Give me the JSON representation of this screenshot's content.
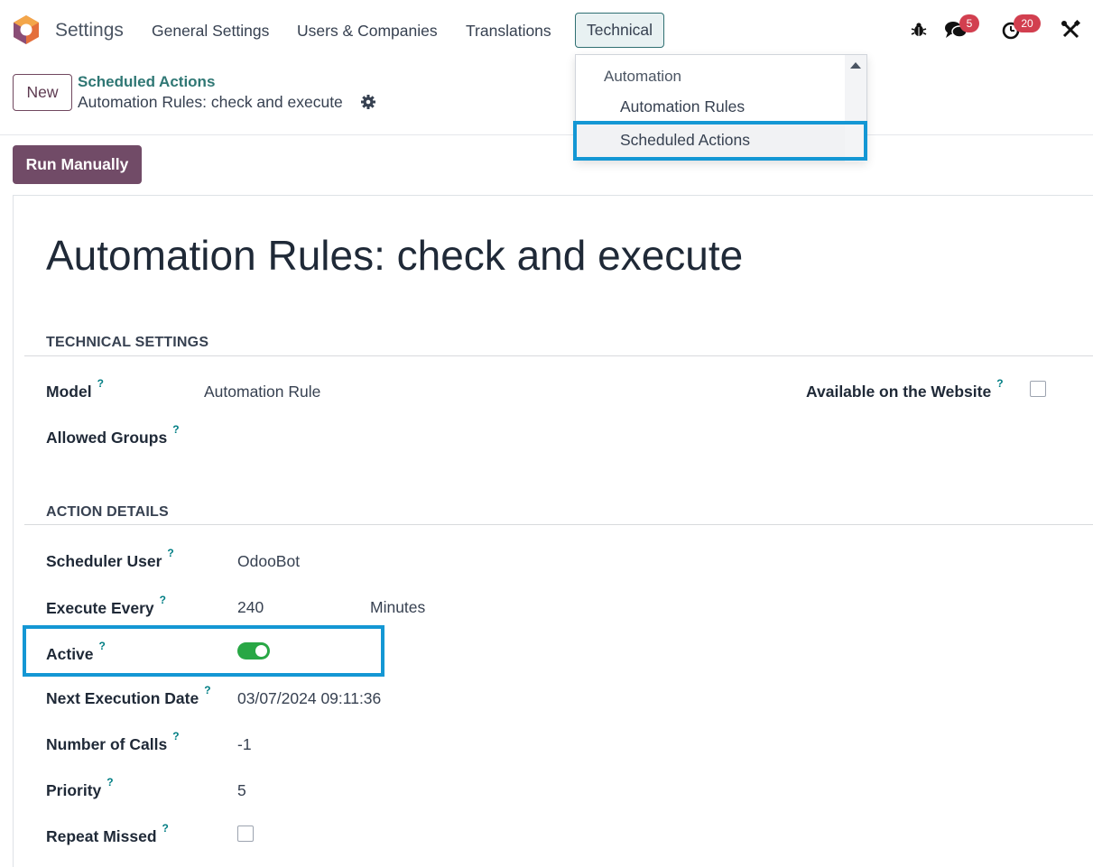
{
  "navbar": {
    "app_name": "Settings",
    "menu": [
      "General Settings",
      "Users & Companies",
      "Translations",
      "Technical"
    ],
    "messages_badge": "5",
    "activities_badge": "20",
    "icons": [
      "bug-icon",
      "chat-icon",
      "clock-icon",
      "tools-icon"
    ]
  },
  "control": {
    "new_label": "New",
    "breadcrumb_parent": "Scheduled Actions",
    "breadcrumb_current": "Automation Rules: check and execute"
  },
  "run_label": "Run Manually",
  "dropdown": {
    "header": "Automation",
    "items": [
      "Automation Rules",
      "Scheduled Actions"
    ],
    "highlighted": "Scheduled Actions"
  },
  "form": {
    "title": "Automation Rules: check and execute",
    "section_technical": "TECHNICAL SETTINGS",
    "model_label": "Model",
    "model_value": "Automation Rule",
    "website_label": "Available on the Website",
    "website_checked": false,
    "groups_label": "Allowed Groups",
    "section_action": "ACTION DETAILS",
    "scheduler_label": "Scheduler User",
    "scheduler_value": "OdooBot",
    "every_label": "Execute Every",
    "every_value": "240",
    "every_unit": "Minutes",
    "active_label": "Active",
    "active_value": true,
    "next_label": "Next Execution Date",
    "next_value": "03/07/2024 09:11:36",
    "calls_label": "Number of Calls",
    "calls_value": "-1",
    "priority_label": "Priority",
    "priority_value": "5",
    "repeat_label": "Repeat Missed",
    "repeat_checked": false,
    "help_mark": "?"
  },
  "colors": {
    "brand": "#714b67",
    "teal": "#017e84",
    "highlight": "#1497d4",
    "toggle_on": "#28a745",
    "badge": "#d23f4f"
  }
}
